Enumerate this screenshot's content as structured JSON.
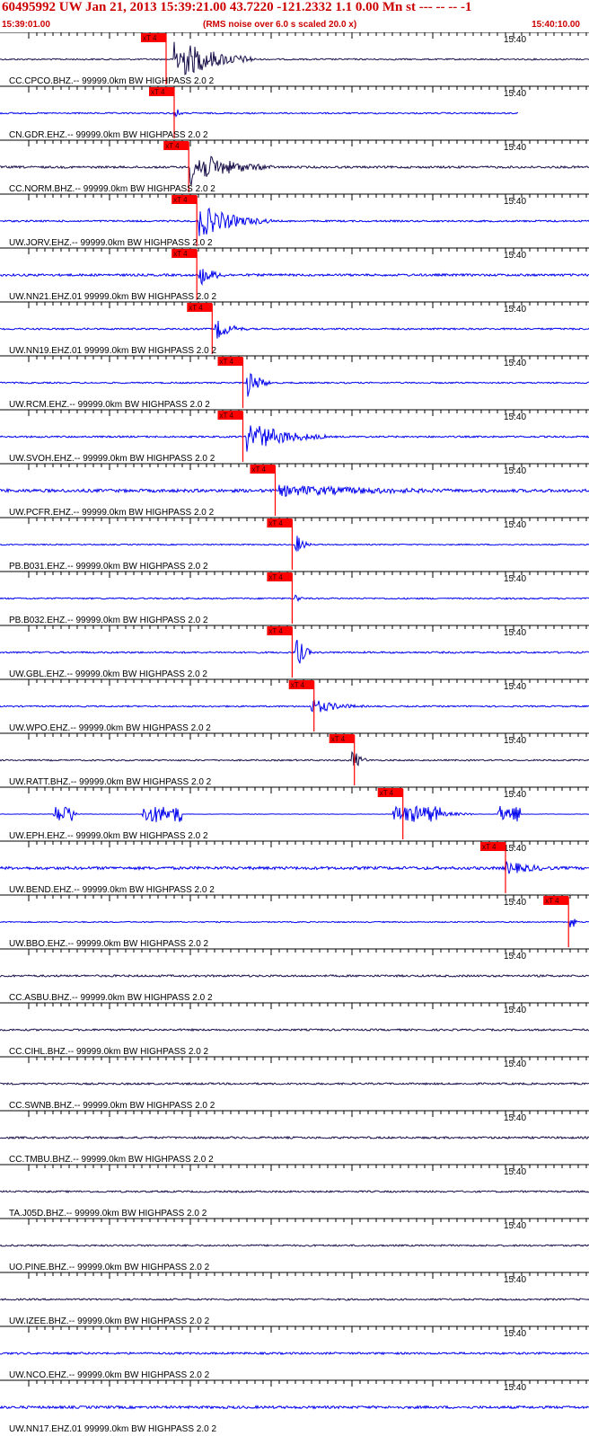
{
  "header": {
    "title": "60495992 UW Jan 21, 2013 15:39:21.00   43.7220 -121.2332  1.1 0.00 Mn st --- -- --  -1",
    "start_time": "15:39:01.00",
    "noise_note": "(RMS noise over 6.0 s scaled 20.0 x)",
    "end_time": "15:40:10.00",
    "minute_label": "15:40"
  },
  "colors": {
    "header_red": "#cc0000",
    "trace_blue": "#0000ee",
    "trace_dark": "#1a0f4a",
    "pick_red": "#ff0000",
    "axis_black": "#000000"
  },
  "chart_data": {
    "type": "line",
    "description_kind": "seismogram record section",
    "time_range": [
      "15:39:01.00",
      "15:40:10.00"
    ],
    "minute_mark": "15:40",
    "pick_label": "xT 4",
    "traces": [
      {
        "label": "CC.CPCO.BHZ.-- 99999.0km BW  HIGHPASS  2.0  2",
        "color": "dark",
        "pick_s": 17.0,
        "burst_s": [
          18,
          28
        ],
        "amp": 1.0,
        "noise": 0.1
      },
      {
        "label": "CN.GDR.EHZ.-- 99999.0km BW  HIGHPASS  2.0  2",
        "color": "blue",
        "pick_s": 18.0,
        "burst_s": [
          18,
          19
        ],
        "amp": 0.45,
        "noise": 0.1
      },
      {
        "label": "CC.NORM.BHZ.-- 99999.0km BW  HIGHPASS  2.0  2",
        "color": "dark",
        "pick_s": 19.8,
        "burst_s": [
          20,
          30
        ],
        "amp": 0.8,
        "noise": 0.15
      },
      {
        "label": "UW.JORV.EHZ.-- 99999.0km BW  HIGHPASS  2.0  2",
        "color": "blue",
        "pick_s": 20.8,
        "burst_s": [
          21,
          30
        ],
        "amp": 0.75,
        "noise": 0.12
      },
      {
        "label": "UW.NN21.EHZ.01 99999.0km BW  HIGHPASS  2.0  2",
        "color": "blue",
        "pick_s": 20.8,
        "burst_s": [
          21,
          25
        ],
        "amp": 0.5,
        "noise": 0.16
      },
      {
        "label": "UW.NN19.EHZ.01 99999.0km BW  HIGHPASS  2.0  2",
        "color": "blue",
        "pick_s": 22.7,
        "burst_s": [
          23,
          27
        ],
        "amp": 0.5,
        "noise": 0.12
      },
      {
        "label": "UW.RCM.EHZ.-- 99999.0km BW  HIGHPASS  2.0  2",
        "color": "blue",
        "pick_s": 26.5,
        "burst_s": [
          27,
          30
        ],
        "amp": 0.7,
        "noise": 0.1
      },
      {
        "label": "UW.SVOH.EHZ.-- 99999.0km BW  HIGHPASS  2.0  2",
        "color": "blue",
        "pick_s": 26.5,
        "burst_s": [
          27,
          37
        ],
        "amp": 0.7,
        "noise": 0.12
      },
      {
        "label": "UW.PCFR.EHZ.-- 99999.0km BW  HIGHPASS  2.0  2",
        "color": "blue",
        "pick_s": 30.5,
        "burst_s": [
          31,
          68
        ],
        "amp": 0.25,
        "noise": 0.22
      },
      {
        "label": "PB.B031.EHZ.-- 99999.0km BW  HIGHPASS  2.0  2",
        "color": "blue",
        "pick_s": 32.6,
        "burst_s": [
          33,
          35
        ],
        "amp": 0.5,
        "noise": 0.08
      },
      {
        "label": "PB.B032.EHZ.-- 99999.0km BW  HIGHPASS  2.0  2",
        "color": "blue",
        "pick_s": 32.6,
        "burst_s": [
          33,
          34
        ],
        "amp": 0.3,
        "noise": 0.1
      },
      {
        "label": "UW.GBL.EHZ.-- 99999.0km BW  HIGHPASS  2.0  2",
        "color": "blue",
        "pick_s": 32.6,
        "burst_s": [
          33,
          35
        ],
        "amp": 0.9,
        "noise": 0.12
      },
      {
        "label": "UW.WPO.EHZ.-- 99999.0km BW  HIGHPASS  2.0  2",
        "color": "blue",
        "pick_s": 35.3,
        "burst_s": [
          35,
          42
        ],
        "amp": 0.35,
        "noise": 0.1
      },
      {
        "label": "UW.RATT.BHZ.-- 99999.0km BW  HIGHPASS  2.0  2",
        "color": "dark",
        "pick_s": 40.3,
        "burst_s": [
          40,
          42
        ],
        "amp": 0.55,
        "noise": 0.1
      },
      {
        "label": "UW.EPH.EHZ.-- 99999.0km BW  HIGHPASS  2.0  2",
        "color": "blue",
        "pick_s": 46.3,
        "burst_s": [
          46,
          55
        ],
        "amp": 0.35,
        "noise": 0.0
      },
      {
        "label": "UW.BEND.EHZ.-- 99999.0km BW  HIGHPASS  2.0  2",
        "color": "blue",
        "pick_s": 59.0,
        "burst_s": [
          59,
          68
        ],
        "amp": 0.3,
        "noise": 0.2
      },
      {
        "label": "UW.BBO.EHZ.-- 99999.0km BW  HIGHPASS  2.0  2",
        "color": "blue",
        "pick_s": 66.8,
        "burst_s": [
          67,
          68
        ],
        "amp": 0.6,
        "noise": 0.08
      },
      {
        "label": "CC.ASBU.BHZ.-- 99999.0km BW  HIGHPASS  2.0  2",
        "color": "dark",
        "pick_s": null,
        "burst_s": null,
        "amp": 0,
        "noise": 0.14
      },
      {
        "label": "CC.CIHL.BHZ.-- 99999.0km BW  HIGHPASS  2.0  2",
        "color": "dark",
        "pick_s": null,
        "burst_s": null,
        "amp": 0,
        "noise": 0.13
      },
      {
        "label": "CC.SWNB.BHZ.-- 99999.0km BW  HIGHPASS  2.0  2",
        "color": "dark",
        "pick_s": null,
        "burst_s": null,
        "amp": 0,
        "noise": 0.13
      },
      {
        "label": "CC.TMBU.BHZ.-- 99999.0km BW  HIGHPASS  2.0  2",
        "color": "dark",
        "pick_s": null,
        "burst_s": null,
        "amp": 0,
        "noise": 0.14
      },
      {
        "label": "TA.J05D.BHZ.-- 99999.0km BW  HIGHPASS  2.0  2",
        "color": "dark",
        "pick_s": null,
        "burst_s": null,
        "amp": 0,
        "noise": 0.12
      },
      {
        "label": "UO.PINE.BHZ.-- 99999.0km BW  HIGHPASS  2.0  2",
        "color": "dark",
        "pick_s": null,
        "burst_s": null,
        "amp": 0,
        "noise": 0.12
      },
      {
        "label": "UW.IZEE.BHZ.-- 99999.0km BW  HIGHPASS  2.0  2",
        "color": "dark",
        "pick_s": null,
        "burst_s": null,
        "amp": 0,
        "noise": 0.12
      },
      {
        "label": "UW.NCO.EHZ.-- 99999.0km BW  HIGHPASS  2.0  2",
        "color": "blue",
        "pick_s": null,
        "burst_s": null,
        "amp": 0,
        "noise": 0.14
      },
      {
        "label": "UW.NN17.EHZ.01 99999.0km BW  HIGHPASS  2.0  2",
        "color": "blue",
        "pick_s": null,
        "burst_s": null,
        "amp": 0,
        "noise": 0.18
      }
    ]
  }
}
